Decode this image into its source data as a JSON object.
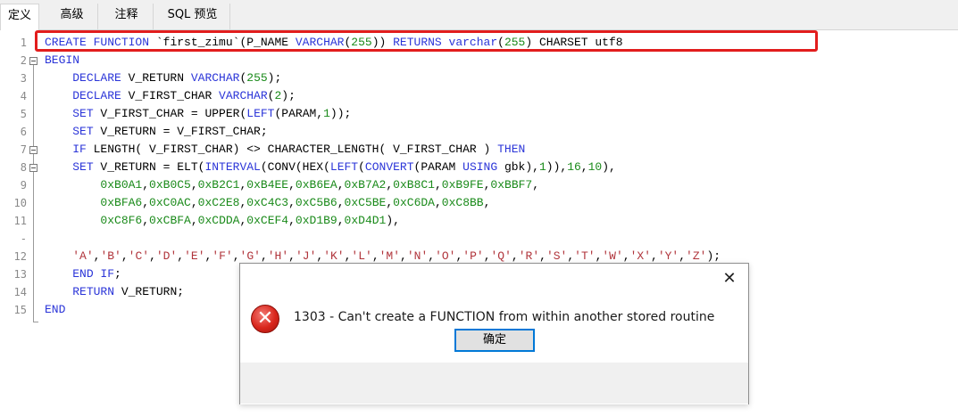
{
  "tabs": [
    {
      "label": "定义",
      "active": true
    },
    {
      "label": "高级",
      "active": false
    },
    {
      "label": "注释",
      "active": false
    },
    {
      "label": "SQL 预览",
      "active": false
    }
  ],
  "editor": {
    "line_numbers": [
      "1",
      "2",
      "3",
      "4",
      "5",
      "6",
      "7",
      "8",
      "9",
      "10",
      "11",
      "-",
      "12",
      "13",
      "14",
      "15"
    ],
    "lines": [
      "CREATE FUNCTION `first_zimu`(P_NAME VARCHAR(255)) RETURNS varchar(255) CHARSET utf8",
      "BEGIN",
      "    DECLARE V_RETURN VARCHAR(255);",
      "    DECLARE V_FIRST_CHAR VARCHAR(2);",
      "    SET V_FIRST_CHAR = UPPER(LEFT(PARAM,1));",
      "    SET V_RETURN = V_FIRST_CHAR;",
      "    IF LENGTH( V_FIRST_CHAR) <> CHARACTER_LENGTH( V_FIRST_CHAR ) THEN",
      "    SET V_RETURN = ELT(INTERVAL(CONV(HEX(LEFT(CONVERT(PARAM USING gbk),1)),16,10),",
      "        0xB0A1,0xB0C5,0xB2C1,0xB4EE,0xB6EA,0xB7A2,0xB8C1,0xB9FE,0xBBF7,",
      "        0xBFA6,0xC0AC,0xC2E8,0xC4C3,0xC5B6,0xC5BE,0xC6DA,0xC8BB,",
      "        0xC8F6,0xCBFA,0xCDDA,0xCEF4,0xD1B9,0xD4D1),",
      "    'A','B','C','D','E','F','G','H','J','K','L','M','N','O','P','Q','R','S','T','W','X','Y','Z');",
      "    END IF;",
      "    RETURN V_RETURN;",
      "END"
    ]
  },
  "dialog": {
    "close_glyph": "✕",
    "icon": "error-icon",
    "icon_glyph": "✕",
    "message": "1303 - Can't create a FUNCTION from within another stored routine",
    "ok_label": "确定"
  },
  "colors": {
    "keyword": "#2b35d8",
    "number": "#1a8a1a",
    "string": "#b0343b",
    "highlight_border": "#e21d1d",
    "button_focus": "#0078d7"
  }
}
